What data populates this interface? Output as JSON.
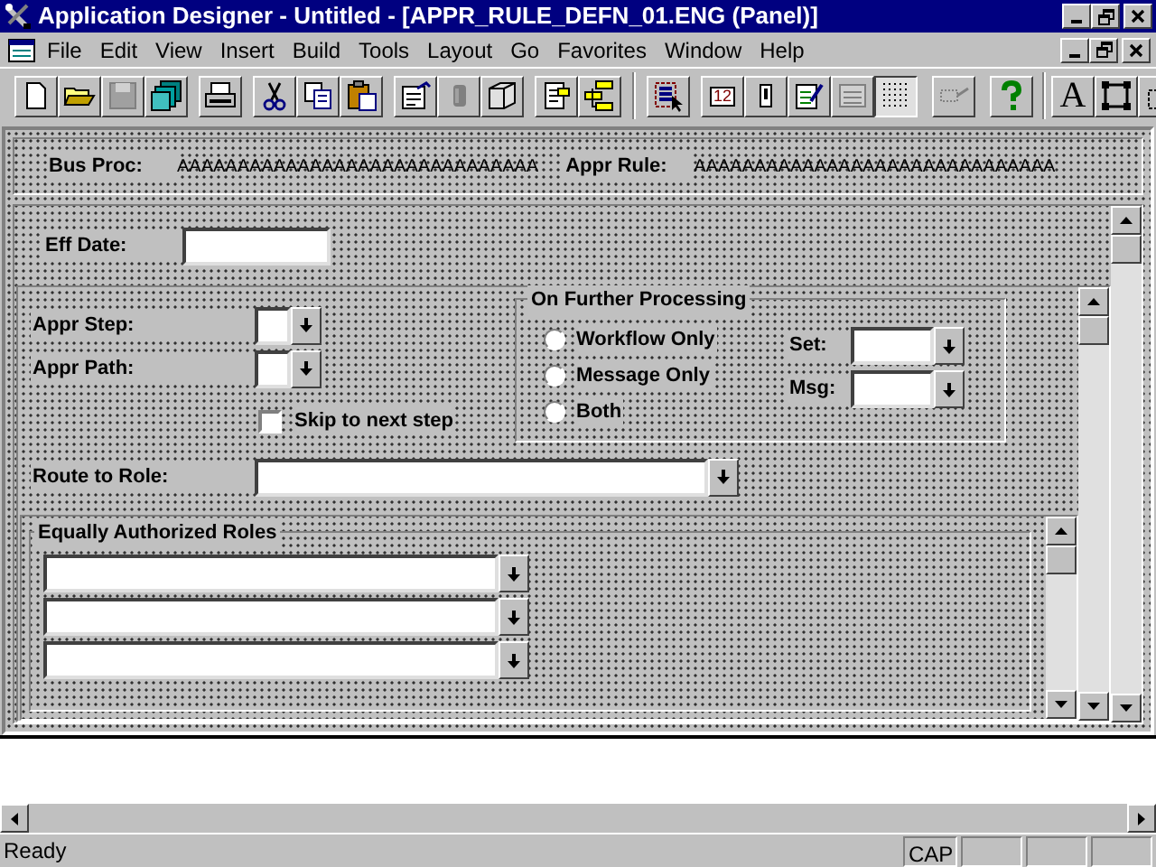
{
  "window": {
    "title": "Application Designer - Untitled - [APPR_RULE_DEFN_01.ENG (Panel)]"
  },
  "menu": [
    "File",
    "Edit",
    "View",
    "Insert",
    "Build",
    "Tools",
    "Layout",
    "Go",
    "Favorites",
    "Window",
    "Help"
  ],
  "toolbar": {
    "tab_order_button": "12",
    "text_button": "A"
  },
  "header": {
    "fields": [
      {
        "label": "Bus Proc:",
        "value": "AAAAAAAAAAAAAAAAAAAAAAAAAAAAAA"
      },
      {
        "label": "Appr Rule:",
        "value": "AAAAAAAAAAAAAAAAAAAAAAAAAAAAAA"
      }
    ]
  },
  "eff_date": {
    "label": "Eff Date:"
  },
  "appr_step": {
    "label": "Appr Step:"
  },
  "appr_path": {
    "label": "Appr Path:"
  },
  "skip": {
    "label": "Skip to next step",
    "checked": false
  },
  "further_processing": {
    "title": "On Further Processing",
    "options": [
      {
        "label": "Workflow Only",
        "selected": false
      },
      {
        "label": "Message Only",
        "selected": false
      },
      {
        "label": "Both",
        "selected": false
      }
    ],
    "set": {
      "label": "Set:"
    },
    "msg": {
      "label": "Msg:"
    }
  },
  "route_to_role": {
    "label": "Route to Role:"
  },
  "equally_authorized_roles": {
    "title": "Equally Authorized Roles",
    "fields": [
      {
        "kind": "dropdown"
      },
      {
        "kind": "dropdown"
      },
      {
        "kind": "dropdown"
      }
    ]
  },
  "status_bar": {
    "message": "Ready",
    "panes": [
      "CAP"
    ]
  }
}
